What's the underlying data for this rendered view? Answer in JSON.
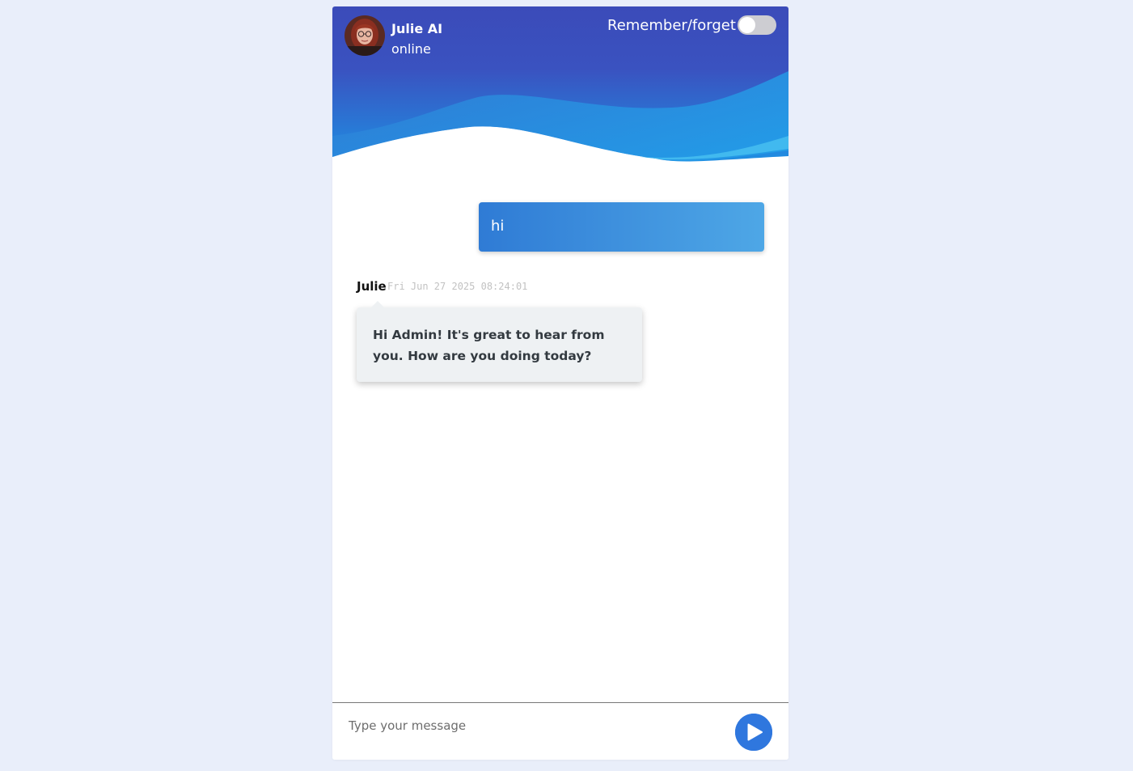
{
  "header": {
    "bot_name": "Julie AI",
    "status": "online",
    "memory_toggle_label": "Remember/forget",
    "memory_toggle_on": false
  },
  "messages": [
    {
      "role": "user",
      "text": "hi"
    },
    {
      "role": "bot",
      "sender": "Julie",
      "timestamp": "Fri Jun 27 2025 08:24:01",
      "text": "Hi Admin! It's great to hear from you. How are you doing today?"
    }
  ],
  "composer": {
    "placeholder": "Type your message",
    "value": "",
    "send_icon": "play-icon"
  },
  "colors": {
    "page_bg": "#e9eefa",
    "header_top": "#3b4bb9",
    "header_wave": "#1e98e6",
    "user_bubble_start": "#2f7bd5",
    "user_bubble_end": "#4ea7e6",
    "bot_bubble": "#eef1f3",
    "send_button": "#2f77de"
  }
}
